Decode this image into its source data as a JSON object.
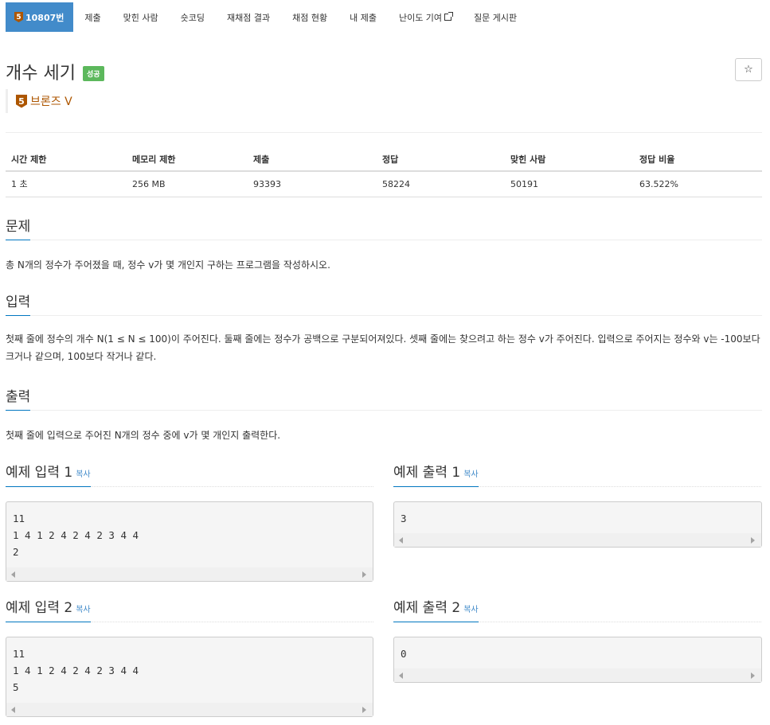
{
  "nav": {
    "problem_tab": {
      "tier": "5",
      "label": "10807번"
    },
    "tabs": [
      "제출",
      "맞힌 사람",
      "숏코딩",
      "재채점 결과",
      "채점 현황",
      "내 제출",
      "난이도 기여",
      "질문 게시판"
    ]
  },
  "problem": {
    "title": "개수 세기",
    "result_badge": "성공",
    "star": "☆",
    "tier_number": "5",
    "tier_label": "브론즈 V"
  },
  "info": {
    "headers": [
      "시간 제한",
      "메모리 제한",
      "제출",
      "정답",
      "맞힌 사람",
      "정답 비율"
    ],
    "values": [
      "1 초",
      "256 MB",
      "93393",
      "58224",
      "50191",
      "63.522%"
    ]
  },
  "sections": {
    "problem_heading": "문제",
    "problem_text": "총 N개의 정수가 주어졌을 때, 정수 v가 몇 개인지 구하는 프로그램을 작성하시오.",
    "input_heading": "입력",
    "input_text": "첫째 줄에 정수의 개수 N(1 ≤ N ≤ 100)이 주어진다. 둘째 줄에는 정수가 공백으로 구분되어져있다. 셋째 줄에는 찾으려고 하는 정수 v가 주어진다. 입력으로 주어지는 정수와 v는 -100보다 크거나 같으며, 100보다 작거나 같다.",
    "output_heading": "출력",
    "output_text": "첫째 줄에 입력으로 주어진 N개의 정수 중에 v가 몇 개인지 출력한다."
  },
  "samples": {
    "copy_label": "복사",
    "input1_title": "예제 입력 1",
    "input1": "11\n1 4 1 2 4 2 4 2 3 4 4\n2",
    "output1_title": "예제 출력 1",
    "output1": "3",
    "input2_title": "예제 입력 2",
    "input2": "11\n1 4 1 2 4 2 4 2 3 4 4\n5",
    "output2_title": "예제 출력 2",
    "output2": "0"
  },
  "colors": {
    "nav_active": "#428bca",
    "success": "#5cb85c",
    "bronze": "#ad5600",
    "link": "#428bca"
  }
}
